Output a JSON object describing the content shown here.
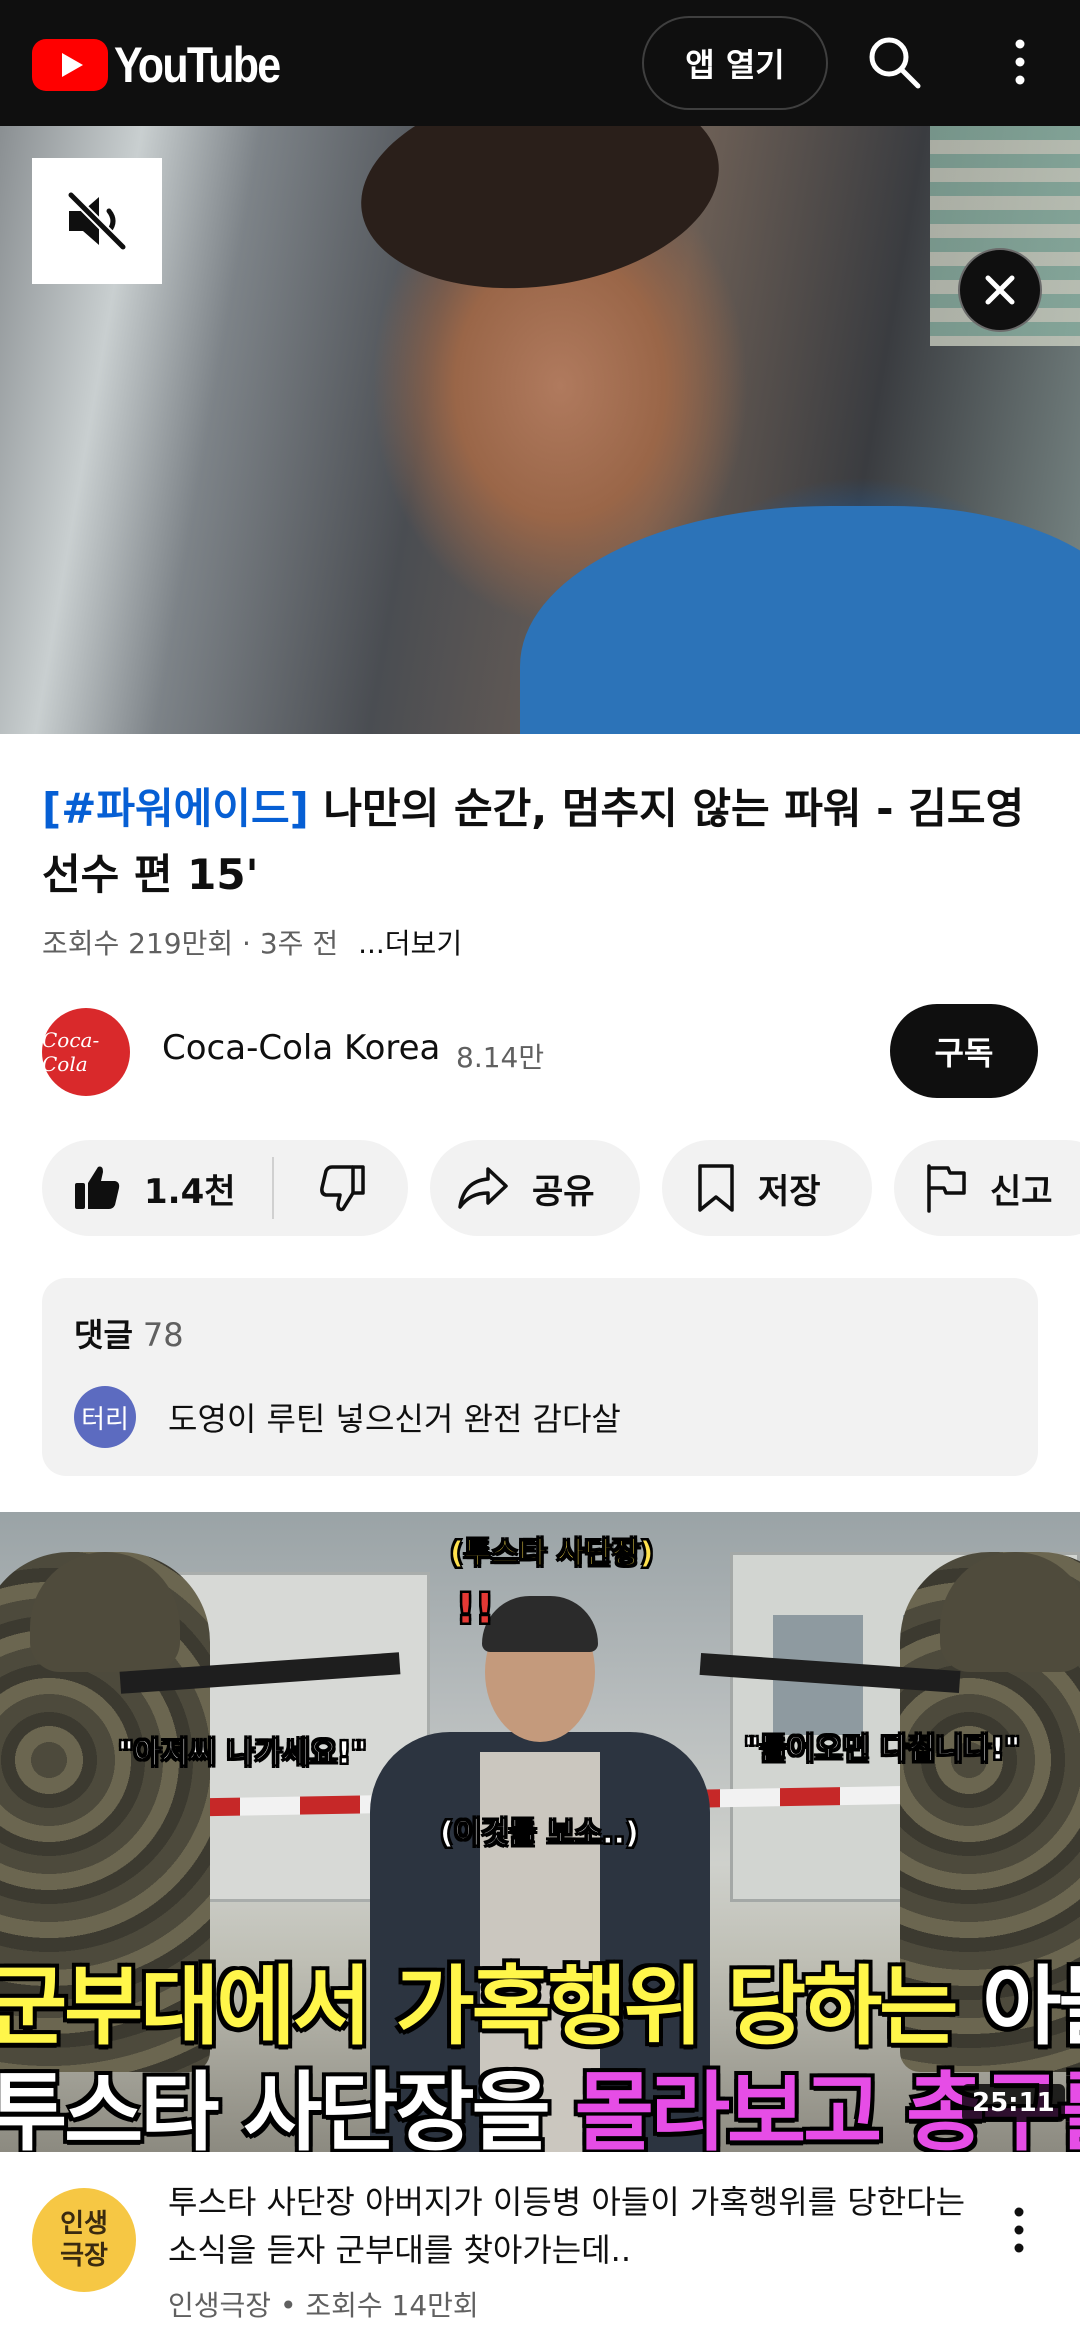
{
  "header": {
    "logo_text": "YouTube",
    "open_app_label": "앱 열기",
    "icons": [
      "youtube-logo-icon",
      "search-icon",
      "more-vert-icon"
    ]
  },
  "player": {
    "icons": [
      "mute-icon",
      "close-icon"
    ]
  },
  "video": {
    "title_hashtag": "[#파워에이드]",
    "title_rest": " 나만의 순간, 멈추지 않는 파워 - 김도영 선수 편 15'",
    "meta": "조회수 219만회 · 3주 전",
    "more_label": "...더보기"
  },
  "channel": {
    "avatar_text": "Coca-Cola",
    "name": "Coca-Cola Korea",
    "subscribers": "8.14만",
    "subscribe_label": "구독"
  },
  "actions": {
    "like_count": "1.4천",
    "share_label": "공유",
    "save_label": "저장",
    "report_label": "신고"
  },
  "comments": {
    "header_label": "댓글",
    "count": "78",
    "top_comment_avatar": "터리",
    "top_comment_text": "도영이 루틴 넣으신거 완전 감다살"
  },
  "recommended": {
    "thumbnail": {
      "tag_top": "(투스타 사단장)",
      "exclamation": "!!",
      "quote_left": "\"아저씨 나가세요!\"",
      "quote_right": "\"들어오면 다칩니다!\"",
      "quote_center": "(이것들 보소..)",
      "caption1_yellow": "군부대에서 가혹행위 당하는 ",
      "caption1_white": "아들 찾아간",
      "caption2_white": "투스타 사단장을 ",
      "caption2_magenta": "몰라보고 총구를 겨누는데",
      "duration": "25:11"
    },
    "channel_avatar_line1": "인생",
    "channel_avatar_line2": "극장",
    "title": "투스타 사단장 아버지가 이등병 아들이 가혹행위를 당한다는 소식을 듣자 군부대를 찾아가는데..",
    "meta": "인생극장 • 조회수 14만회"
  },
  "colors": {
    "brand_red": "#ff0000",
    "link_blue": "#065fd4",
    "top_bar": "#0f0f0f"
  }
}
